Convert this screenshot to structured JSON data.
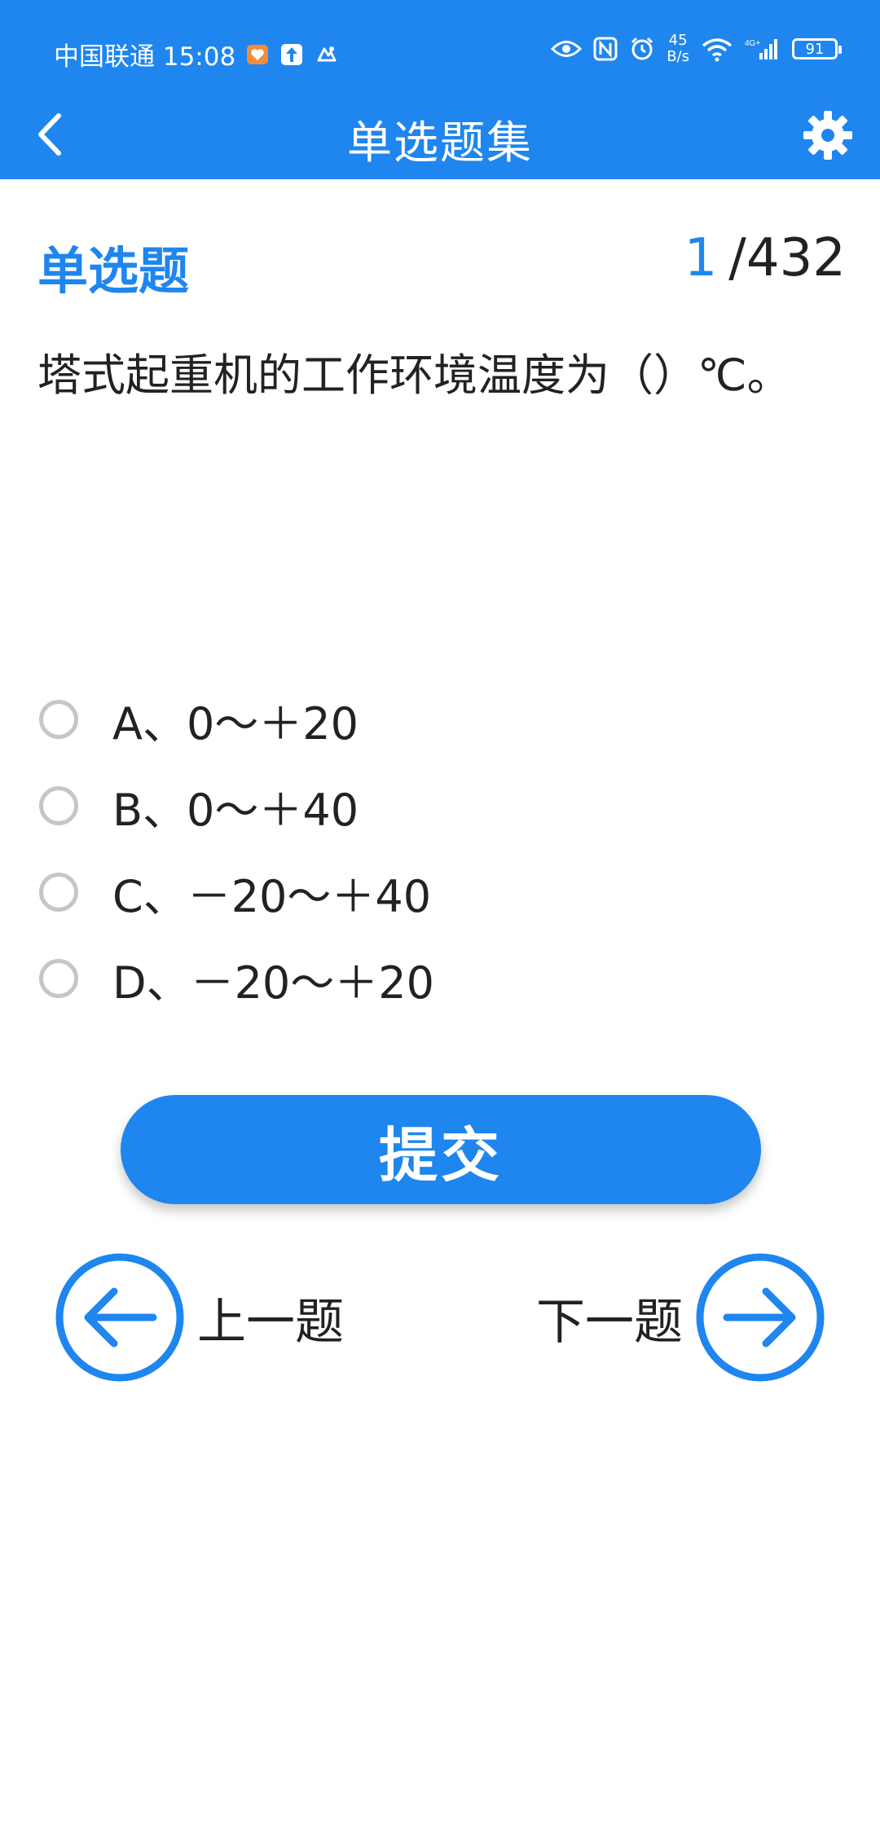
{
  "status_bar": {
    "carrier_time": "中国联通 15:08",
    "net_speed_value": "45",
    "net_speed_unit": "B/s",
    "battery": "91"
  },
  "app_bar": {
    "title": "单选题集"
  },
  "question": {
    "type": "单选题",
    "current": "1",
    "total": "/432",
    "text": "塔式起重机的工作环境温度为（）℃。"
  },
  "options": [
    {
      "label": "A、0～＋20"
    },
    {
      "label": "B、0～＋40"
    },
    {
      "label": "C、－20～＋40"
    },
    {
      "label": "D、－20～＋20"
    }
  ],
  "actions": {
    "submit": "提交",
    "prev": "上一题",
    "next": "下一题"
  },
  "colors": {
    "accent": "#1e86ee",
    "text": "#222222",
    "radio_border": "#c6c6c6"
  }
}
